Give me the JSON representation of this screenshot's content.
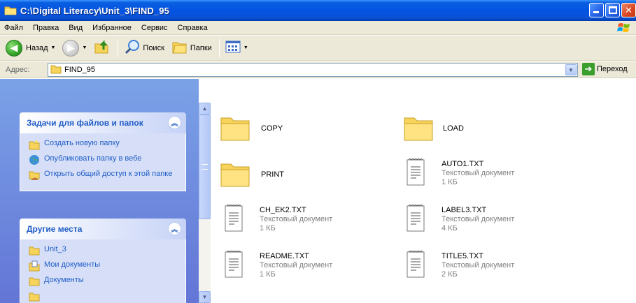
{
  "window": {
    "title": "C:\\Digital Literacy\\Unit_3\\FIND_95"
  },
  "menubar": {
    "items": [
      "Файл",
      "Правка",
      "Вид",
      "Избранное",
      "Сервис",
      "Справка"
    ]
  },
  "toolbar": {
    "back_label": "Назад",
    "search_label": "Поиск",
    "folders_label": "Папки"
  },
  "addressbar": {
    "label": "Адрес:",
    "value": "FIND_95",
    "go_label": "Переход"
  },
  "taskpane": {
    "file_tasks": {
      "title": "Задачи для файлов и папок",
      "items": [
        {
          "label": "Создать новую папку",
          "icon": "new-folder-icon"
        },
        {
          "label": "Опубликовать папку в вебе",
          "icon": "web-publish-icon"
        },
        {
          "label": "Открыть общий доступ к этой папке",
          "icon": "share-folder-icon"
        }
      ]
    },
    "other_places": {
      "title": "Другие места",
      "items": [
        {
          "label": "Unit_3",
          "icon": "folder-icon"
        },
        {
          "label": "Мои документы",
          "icon": "my-documents-icon"
        },
        {
          "label": "Документы",
          "icon": "folder-icon"
        }
      ]
    }
  },
  "files": [
    {
      "name": "COPY",
      "type": "folder"
    },
    {
      "name": "LOAD",
      "type": "folder"
    },
    {
      "name": "PRINT",
      "type": "folder"
    },
    {
      "name": "AUTO1.TXT",
      "type": "text",
      "kind": "Текстовый документ",
      "size": "1 КБ"
    },
    {
      "name": "CH_EK2.TXT",
      "type": "text",
      "kind": "Текстовый документ",
      "size": "1 КБ"
    },
    {
      "name": "LABEL3.TXT",
      "type": "text",
      "kind": "Текстовый документ",
      "size": "4 КБ"
    },
    {
      "name": "README.TXT",
      "type": "text",
      "kind": "Текстовый документ",
      "size": "1 КБ"
    },
    {
      "name": "TITLE5.TXT",
      "type": "text",
      "kind": "Текстовый документ",
      "size": "2 КБ"
    }
  ],
  "colors": {
    "titlebar": "#0454e2",
    "chrome": "#ece9d8",
    "taskpane": "#6f8ce0",
    "link": "#215dc6"
  }
}
